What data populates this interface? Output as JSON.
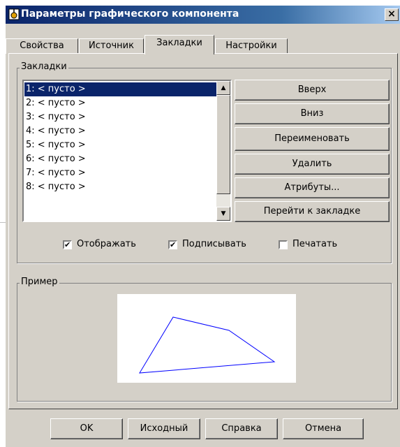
{
  "window": {
    "title": "Параметры графического компонента",
    "close_glyph": "×"
  },
  "tabs": [
    {
      "label": "Свойства"
    },
    {
      "label": "Источник"
    },
    {
      "label": "Закладки"
    },
    {
      "label": "Настройки"
    }
  ],
  "bookmarks_group": {
    "label": "Закладки",
    "items": [
      "1: < пусто >",
      "2: < пусто >",
      "3: < пусто >",
      "4: < пусто >",
      "5: < пусто >",
      "6: < пусто >",
      "7: < пусто >",
      "8: < пусто >"
    ],
    "selected_index": 0,
    "buttons": {
      "up": "Вверх",
      "down": "Вниз",
      "rename": "Переименовать",
      "delete": "Удалить",
      "attributes": "Атрибуты...",
      "goto": "Перейти к закладке"
    },
    "checkboxes": {
      "display": {
        "label": "Отображать",
        "checked": true
      },
      "sign": {
        "label": "Подписывать",
        "checked": true
      },
      "print": {
        "label": "Печатать",
        "checked": false
      }
    }
  },
  "example_group": {
    "label": "Пример",
    "shape_color": "#0000ff"
  },
  "footer": {
    "ok": "OK",
    "default": "Исходный",
    "help": "Справка",
    "cancel": "Отмена"
  },
  "colors": {
    "title_bar": "#0a246a",
    "selection": "#0a246a",
    "face": "#d4d0c8"
  }
}
